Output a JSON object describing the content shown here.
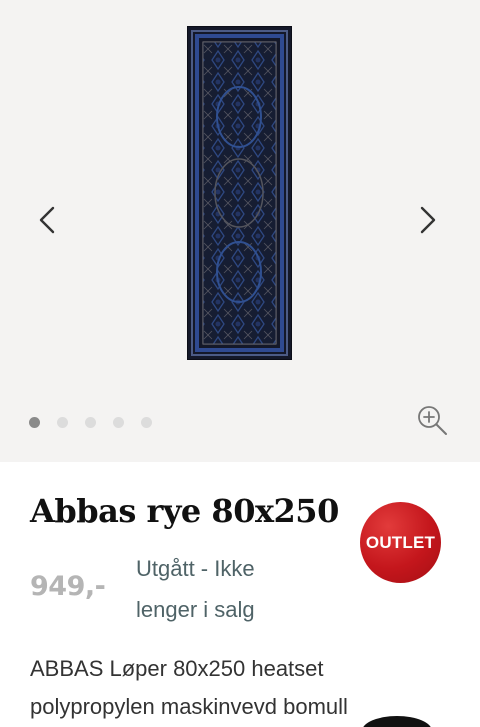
{
  "product": {
    "title": "Abbas rye 80x250",
    "price": "949,-",
    "status_line1": "Utgått - Ikke",
    "status_line2": "lenger i salg",
    "badge": "OUTLET",
    "description_line1": "ABBAS Løper 80x250 heatset",
    "description_line2": "polypropylen maskinvevd bomull"
  },
  "gallery": {
    "image_count": 5,
    "active_index": 0,
    "prev_icon": "chevron-left-icon",
    "next_icon": "chevron-right-icon",
    "zoom_icon": "zoom-in-icon"
  },
  "colors": {
    "badge": "#c4161c",
    "price": "#b5b5b5",
    "status": "#4f6367",
    "gallery_bg": "#f4f3f2",
    "rug_base": "#15192a",
    "rug_pattern": "#2d4a8a"
  }
}
